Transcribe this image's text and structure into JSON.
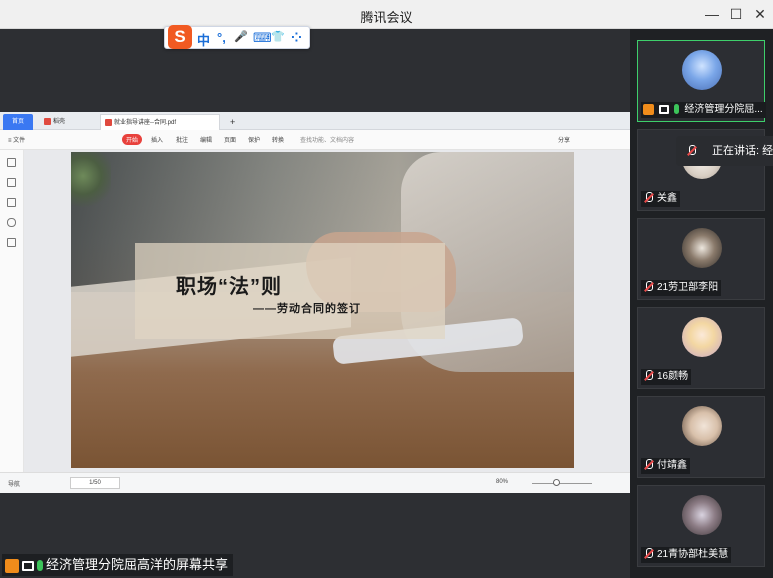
{
  "window": {
    "title": "腾讯会议",
    "minimize": "—",
    "maximize": "☐",
    "close": "✕"
  },
  "ime": {
    "logo": "S",
    "items": [
      "中",
      "°,",
      "🎤",
      "⌨",
      "👕",
      "⁘"
    ]
  },
  "wps": {
    "tabs": {
      "home": "首页",
      "docer": "稻壳",
      "doc": "就业指导讲座--合同.pdf",
      "add": "+"
    },
    "toolbar": {
      "file": "≡ 文件",
      "start": "开始",
      "items": [
        "插入",
        "批注",
        "编辑",
        "页面",
        "保护",
        "转换"
      ],
      "search": "查找功能、文档内容",
      "share": "分享"
    },
    "slide": {
      "title": "职场“法”则",
      "subtitle": "——劳动合同的签订"
    },
    "status": {
      "nav": "导航",
      "page": "1/50",
      "zoom": "80%"
    }
  },
  "share_label": "经济管理分院屈高洋的屏幕共享",
  "speaking": {
    "label": "正在讲话: 经济"
  },
  "participants": [
    {
      "name": "经济管理分院屈...",
      "mic": "on",
      "active": true
    },
    {
      "name": "关鑫",
      "mic": "muted",
      "active": false
    },
    {
      "name": "21劳卫部李阳",
      "mic": "muted",
      "active": false
    },
    {
      "name": "16颜畅",
      "mic": "muted",
      "active": false
    },
    {
      "name": "付靖鑫",
      "mic": "muted",
      "active": false
    },
    {
      "name": "21青协部杜美慧",
      "mic": "muted",
      "active": false
    }
  ],
  "colors": {
    "accent": "#3ecf6b",
    "wps_blue": "#3a78f2",
    "wps_red": "#e8413c",
    "sogou": "#f15a22"
  }
}
